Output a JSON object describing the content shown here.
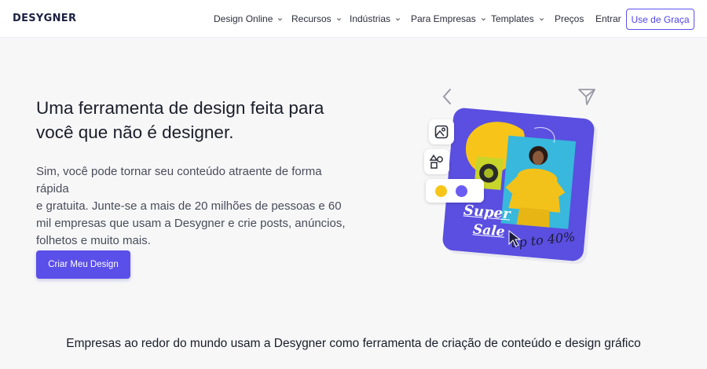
{
  "header": {
    "logo": "DESYGNER",
    "nav": [
      {
        "label": "Design Online",
        "dropdown": true
      },
      {
        "label": "Recursos",
        "dropdown": true
      },
      {
        "label": "Indústrias",
        "dropdown": true
      },
      {
        "label": "Para Empresas",
        "dropdown": true
      },
      {
        "label": "Templates",
        "dropdown": true
      },
      {
        "label": "Preços",
        "dropdown": false
      },
      {
        "label": "Entrar",
        "dropdown": false
      }
    ],
    "cta_label": "Use de Graça"
  },
  "hero": {
    "title_line1": "Uma ferramenta de design feita para",
    "title_line2": "você que não é designer.",
    "description_lines": [
      "Sim, você pode tornar seu conteúdo atraente de forma rápida",
      "e gratuita. Junte-se a mais de 20 milhões de pessoas e 60",
      "mil empresas que usam a Desygner e crie posts, anúncios,",
      "folhetos e muito mais."
    ],
    "button_label": "Criar Meu Design"
  },
  "illustration": {
    "super_text": "Super",
    "sale_text": "Sale",
    "discount_text": "up to 40%",
    "colors": {
      "card": "#5a4fe0",
      "accent_yellow": "#f7c519",
      "dot_purple": "#6a5cf2"
    },
    "icons": [
      "chevron-left-icon",
      "send-icon",
      "image-icon",
      "shapes-icon",
      "cursor-icon"
    ]
  },
  "tagline": "Empresas ao redor do mundo usam a Desygner como ferramenta de criação de conteúdo e design gráfico"
}
